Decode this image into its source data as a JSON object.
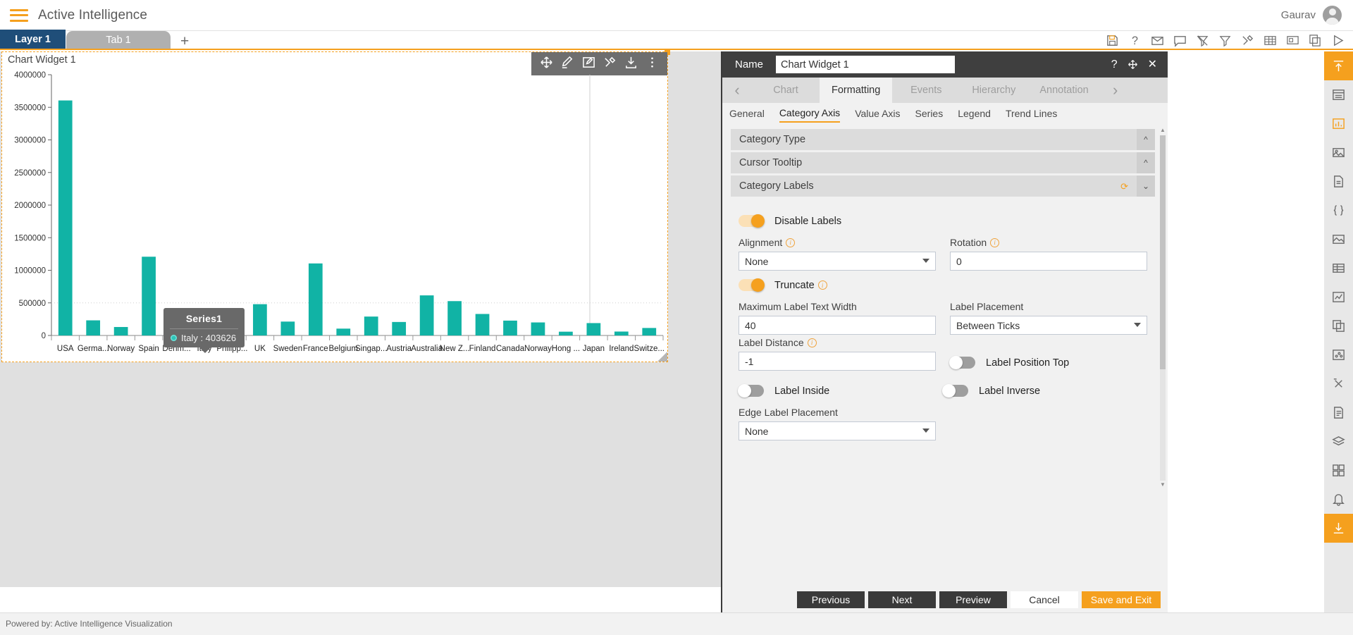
{
  "topbar": {
    "menu_icon": "hamburger-icon",
    "app_title": "Active Intelligence",
    "user_name": "Gaurav",
    "avatar_icon": "user-avatar-icon"
  },
  "tabbar": {
    "layer_tab": "Layer 1",
    "page_tab": "Tab 1",
    "add_tab": "+",
    "icons": [
      "save-icon",
      "help-icon",
      "mail-icon",
      "comment-icon",
      "filter-off-icon",
      "filter-icon",
      "tools-icon",
      "grid-icon",
      "presentation-icon",
      "copy-icon",
      "play-icon"
    ]
  },
  "widget": {
    "title": "Chart Widget 1",
    "toolbar_icons": [
      "move-icon",
      "edit-pen-icon",
      "edit-box-icon",
      "tools-icon",
      "download-icon",
      "more-vertical-icon"
    ]
  },
  "chart_data": {
    "type": "bar",
    "title": "",
    "xlabel": "",
    "ylabel": "",
    "ylim": [
      0,
      4000000
    ],
    "ytick_labels": [
      "0",
      "500000",
      "1000000",
      "1500000",
      "2000000",
      "2500000",
      "3000000",
      "3500000",
      "4000000"
    ],
    "ytick_values": [
      0,
      500000,
      1000000,
      1500000,
      2000000,
      2500000,
      3000000,
      3500000,
      4000000
    ],
    "grid": false,
    "legend": "none",
    "series_name": "Series1",
    "bar_color": "#11b3a5",
    "highlight_color": "#9fe2dc",
    "highlight_category": "Italy",
    "categories": [
      "USA",
      "Germa...",
      "Norway",
      "Spain",
      "Denm...",
      "Italy",
      "Philipp...",
      "UK",
      "Sweden",
      "France",
      "Belgium",
      "Singap...",
      "Austria",
      "Australia",
      "New Z...",
      "Finland",
      "Canada",
      "Norway",
      "Hong ...",
      "Japan",
      "Ireland",
      "Switze..."
    ],
    "values": [
      3605000,
      232000,
      130000,
      1208000,
      250000,
      403626,
      95000,
      480000,
      213000,
      1105000,
      105000,
      290000,
      207000,
      615000,
      527000,
      330000,
      228000,
      200000,
      58000,
      190000,
      60000,
      115000
    ]
  },
  "tooltip": {
    "title": "Series1",
    "marker": "series-dot-icon",
    "text": "Italy : 403626"
  },
  "footer": {
    "powered_by": "Powered by: Active Intelligence Visualization"
  },
  "panel": {
    "name_label": "Name",
    "name_value": "Chart Widget 1",
    "header_icons": [
      "help-icon",
      "move-icon",
      "close-icon"
    ],
    "tabs": [
      {
        "label": "Chart",
        "active": false
      },
      {
        "label": "Formatting",
        "active": true
      },
      {
        "label": "Events",
        "active": false
      },
      {
        "label": "Hierarchy",
        "active": false
      },
      {
        "label": "Annotation",
        "active": false
      }
    ],
    "tab_prev_icon": "chevron-left-icon",
    "tab_next_icon": "chevron-right-icon",
    "subtabs": [
      {
        "label": "General",
        "active": false
      },
      {
        "label": "Category Axis",
        "active": true
      },
      {
        "label": "Value Axis",
        "active": false
      },
      {
        "label": "Series",
        "active": false
      },
      {
        "label": "Legend",
        "active": false
      },
      {
        "label": "Trend Lines",
        "active": false
      }
    ],
    "accordions": [
      {
        "title": "Category Type",
        "expanded": false
      },
      {
        "title": "Cursor Tooltip",
        "expanded": false
      },
      {
        "title": "Category Labels",
        "expanded": true
      }
    ],
    "category_labels": {
      "disable_labels": {
        "label": "Disable Labels",
        "on": true
      },
      "alignment": {
        "label": "Alignment",
        "value": "None",
        "has_info": true
      },
      "rotation": {
        "label": "Rotation",
        "value": "0",
        "has_info": true
      },
      "truncate": {
        "label": "Truncate",
        "on": true,
        "has_info": true
      },
      "max_label_text_width": {
        "label": "Maximum Label Text Width",
        "value": "40"
      },
      "label_placement": {
        "label": "Label Placement",
        "value": "Between Ticks"
      },
      "label_distance": {
        "label": "Label Distance",
        "value": "-1",
        "has_info": true
      },
      "label_position_top": {
        "label": "Label Position Top",
        "on": false
      },
      "label_inside": {
        "label": "Label Inside",
        "on": false
      },
      "label_inverse": {
        "label": "Label Inverse",
        "on": false
      },
      "edge_label_placement": {
        "label": "Edge Label Placement",
        "value": "None"
      }
    },
    "buttons": {
      "previous": "Previous",
      "next": "Next",
      "preview": "Preview",
      "cancel": "Cancel",
      "save_and_exit": "Save and Exit"
    }
  },
  "rail": {
    "icons": [
      "upload-top-icon",
      "list-icon",
      "chart-bar-icon",
      "image-frame-icon",
      "document-icon",
      "code-braces-icon",
      "picture-icon",
      "table-icon",
      "line-chart-icon",
      "layers-copy-icon",
      "scatter-icon",
      "function-icon",
      "page-icon",
      "stack-icon",
      "widget-grid-icon",
      "alert-bell-icon",
      "download-icon"
    ],
    "accent_color": "#f5a01e"
  },
  "colors": {
    "brand_orange": "#f5a01e",
    "layer_tab_blue": "#1f4e79",
    "teal": "#11b3a5",
    "panel_dark": "#3f3f3f"
  }
}
